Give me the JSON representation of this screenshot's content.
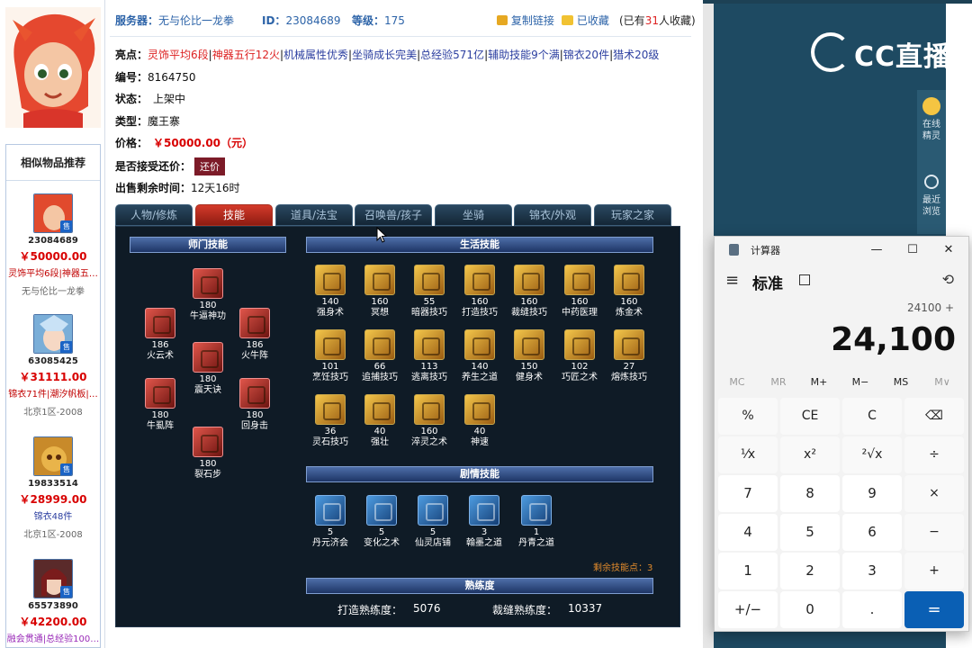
{
  "header": {
    "server_label": "服务器：",
    "server": "无与伦比一龙拳",
    "id_label": "ID：",
    "id": "23084689",
    "level_label": "等级：",
    "level": "175",
    "copy_link": "复制链接",
    "favorited": "已收藏",
    "fav_count_prefix": "(已有",
    "fav_count": "31",
    "fav_count_suffix": "人收藏)"
  },
  "info": {
    "highlights_label": "亮点：",
    "highlights": [
      "灵饰平均6段",
      "神器五行12火",
      "机械属性优秀",
      "坐骑成长完美",
      "总经验571亿",
      "辅助技能9个满",
      "锦衣20件",
      "猎术20级"
    ],
    "number_label": "编号：",
    "number": "8164750",
    "status_label": "状态：",
    "status": "上架中",
    "type_label": "类型：",
    "type": "魔王寨",
    "price_label": "价格：",
    "price": "￥50000.00（元）",
    "counter_label": "是否接受还价：",
    "counter_btn": "还价",
    "remain_label": "出售剩余时间：",
    "remain": "12天16时"
  },
  "similar": {
    "title": "相似物品推荐",
    "badge": "售",
    "items": [
      {
        "id": "23084689",
        "price": "￥50000.00",
        "desc": "灵饰平均6段|神器五…",
        "server": "无与伦比一龙拳",
        "desc_color": "#c00000"
      },
      {
        "id": "63085425",
        "price": "￥31111.00",
        "desc": "锦衣71件|潮汐帆板|…",
        "server": "北京1区-2008",
        "desc_color": "#c00000"
      },
      {
        "id": "19833514",
        "price": "￥28999.00",
        "desc": "锦衣48件",
        "server": "北京1区-2008",
        "desc_color": "#2c3fa0"
      },
      {
        "id": "65573890",
        "price": "￥42200.00",
        "desc": "融会贯通|总经验100…",
        "server": "",
        "desc_color": "#9a2cb8"
      }
    ]
  },
  "tabs": [
    "人物/修炼",
    "技能",
    "道具/法宝",
    "召唤兽/孩子",
    "坐骑",
    "锦衣/外观",
    "玩家之家"
  ],
  "skills": {
    "school_title": "师门技能",
    "life_title": "生活技能",
    "plot_title": "剧情技能",
    "prof_title": "熟练度",
    "school": [
      {
        "lv": "180",
        "name": "牛逼神功"
      },
      {
        "lv": "186",
        "name": "火云术"
      },
      {
        "lv": "186",
        "name": "火牛阵"
      },
      {
        "lv": "180",
        "name": "震天诀"
      },
      {
        "lv": "180",
        "name": "牛虱阵"
      },
      {
        "lv": "180",
        "name": "回身击"
      },
      {
        "lv": "180",
        "name": "裂石步"
      }
    ],
    "life": [
      {
        "lv": "140",
        "name": "强身术"
      },
      {
        "lv": "160",
        "name": "冥想"
      },
      {
        "lv": "55",
        "name": "暗器技巧"
      },
      {
        "lv": "160",
        "name": "打造技巧"
      },
      {
        "lv": "160",
        "name": "裁缝技巧"
      },
      {
        "lv": "160",
        "name": "中药医理"
      },
      {
        "lv": "160",
        "name": "炼金术"
      },
      {
        "lv": "101",
        "name": "烹饪技巧"
      },
      {
        "lv": "66",
        "name": "追捕技巧"
      },
      {
        "lv": "113",
        "name": "逃离技巧"
      },
      {
        "lv": "140",
        "name": "养生之道"
      },
      {
        "lv": "150",
        "name": "健身术"
      },
      {
        "lv": "102",
        "name": "巧匠之术"
      },
      {
        "lv": "27",
        "name": "熔炼技巧"
      },
      {
        "lv": "36",
        "name": "灵石技巧"
      },
      {
        "lv": "40",
        "name": "强壮"
      },
      {
        "lv": "160",
        "name": "淬灵之术"
      },
      {
        "lv": "40",
        "name": "神速"
      }
    ],
    "plot": [
      {
        "lv": "5",
        "name": "丹元济会"
      },
      {
        "lv": "5",
        "name": "变化之术"
      },
      {
        "lv": "5",
        "name": "仙灵店铺"
      },
      {
        "lv": "3",
        "name": "翰墨之道"
      },
      {
        "lv": "1",
        "name": "丹青之道"
      }
    ],
    "remaining_points": "剩余技能点：3",
    "forge_label": "打造熟练度：",
    "forge_value": "5076",
    "sew_label": "裁缝熟练度：",
    "sew_value": "10337"
  },
  "cc": {
    "logo": "CC直播",
    "online_label": "在线精灵",
    "recent_label": "最近浏览"
  },
  "calculator": {
    "title": "计算器",
    "mode": "标准",
    "expression": "24100 +",
    "display": "24,100",
    "memory": [
      "MC",
      "MR",
      "M+",
      "M−",
      "MS",
      "M∨"
    ],
    "keys": [
      "%",
      "CE",
      "C",
      "⌫",
      "¹⁄x",
      "x²",
      "²√x",
      "÷",
      "7",
      "8",
      "9",
      "×",
      "4",
      "5",
      "6",
      "−",
      "1",
      "2",
      "3",
      "+",
      "+/−",
      "0",
      ".",
      "="
    ],
    "win_min": "—",
    "win_max": "☐",
    "win_close": "✕",
    "menu": "≡",
    "history": "⟲"
  }
}
